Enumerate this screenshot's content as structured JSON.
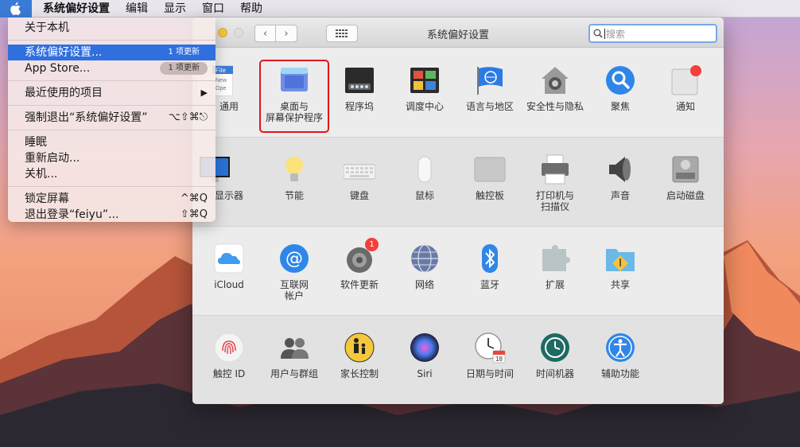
{
  "menubar": {
    "app_name": "系统偏好设置",
    "items": [
      "编辑",
      "显示",
      "窗口",
      "帮助"
    ]
  },
  "apple_menu": {
    "items": [
      {
        "label": "关于本机"
      },
      {
        "label": "系统偏好设置...",
        "badge": "1 项更新"
      },
      {
        "label": "App Store...",
        "badge": "1 项更新"
      },
      {
        "label": "最近使用的项目",
        "arrow": "▶"
      },
      {
        "label": "强制退出“系统偏好设置”",
        "shortcut": "⌥⇧⌘⎋"
      },
      {
        "label": "睡眠"
      },
      {
        "label": "重新启动..."
      },
      {
        "label": "关机..."
      },
      {
        "label": "锁定屏幕",
        "shortcut": "^⌘Q"
      },
      {
        "label": "退出登录“feiyu”...",
        "shortcut": "⇧⌘Q"
      }
    ]
  },
  "window": {
    "title": "系统偏好设置",
    "search_placeholder": "搜索",
    "general_icon_text": [
      "File",
      "New",
      "Ope"
    ]
  },
  "panes": {
    "row1": [
      "通用",
      "桌面与\n屏幕保护程序",
      "程序坞",
      "调度中心",
      "语言与地区",
      "安全性与隐私",
      "聚焦",
      "通知"
    ],
    "row2": [
      "显示器",
      "节能",
      "键盘",
      "鼠标",
      "触控板",
      "打印机与\n扫描仪",
      "声音",
      "启动磁盘"
    ],
    "row3": [
      "iCloud",
      "互联网\n帐户",
      "软件更新",
      "网络",
      "蓝牙",
      "扩展",
      "共享"
    ],
    "row4": [
      "触控 ID",
      "用户与群组",
      "家长控制",
      "Siri",
      "日期与时间",
      "时间机器",
      "辅助功能"
    ]
  },
  "software_update_badge": "1",
  "date_icon_day": "18",
  "colors": {
    "menu_highlight": "#2f6fde",
    "annotation_box": "#e0161b"
  }
}
